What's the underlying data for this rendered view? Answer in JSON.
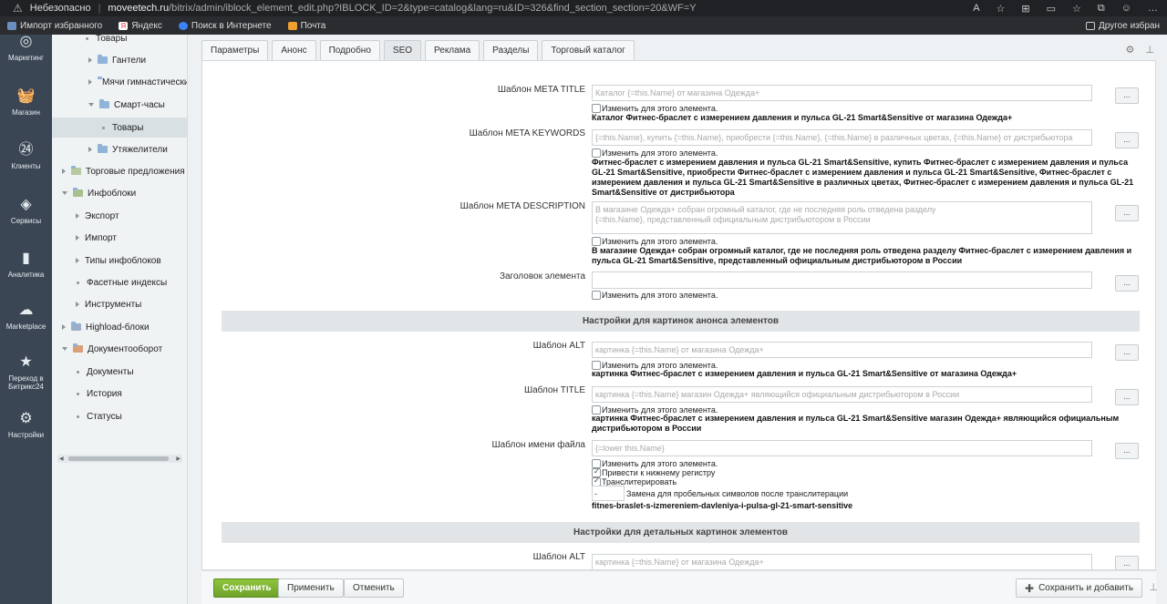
{
  "browser": {
    "security": "Небезопасно",
    "url_host": "moveetech.ru",
    "url_path": "/bitrix/admin/iblock_element_edit.php?IBLOCK_ID=2&type=catalog&lang=ru&ID=326&find_section_section=20&WF=Y",
    "bookmarks": [
      "Импорт избранного",
      "Яндекс",
      "Поиск в Интернете",
      "Почта"
    ],
    "other_bookmarks": "Другое избран"
  },
  "leftbar": [
    "Маркетинг",
    "Магазин",
    "Клиенты",
    "Сервисы",
    "Аналитика",
    "Marketplace",
    "Переход в Битрикс24",
    "Настройки"
  ],
  "tree": [
    {
      "label": "Товары",
      "type": "dot"
    },
    {
      "label": "Гантели",
      "type": "folder"
    },
    {
      "label": "Мячи гимнастические",
      "type": "folder"
    },
    {
      "label": "Смарт-часы",
      "type": "folder-open"
    },
    {
      "label": "Товары",
      "type": "dot",
      "selected": true
    },
    {
      "label": "Утяжелители",
      "type": "folder"
    },
    {
      "label": "Торговые предложения",
      "type": "top"
    },
    {
      "label": "Инфоблоки",
      "type": "top-open"
    },
    {
      "label": "Экспорт",
      "type": "sub"
    },
    {
      "label": "Импорт",
      "type": "sub"
    },
    {
      "label": "Типы инфоблоков",
      "type": "sub"
    },
    {
      "label": "Фасетные индексы",
      "type": "subdot"
    },
    {
      "label": "Инструменты",
      "type": "sub"
    },
    {
      "label": "Highload-блоки",
      "type": "top"
    },
    {
      "label": "Документооборот",
      "type": "top-open"
    },
    {
      "label": "Документы",
      "type": "subdot"
    },
    {
      "label": "История",
      "type": "subdot"
    },
    {
      "label": "Статусы",
      "type": "subdot"
    }
  ],
  "tabs": [
    "Параметры",
    "Анонс",
    "Подробно",
    "SEO",
    "Реклама",
    "Разделы",
    "Торговый каталог"
  ],
  "active_tab": "SEO",
  "form": {
    "meta_title_label": "Шаблон META TITLE",
    "meta_title_value": "Каталог {=this.Name} от магазина Одежда+",
    "meta_title_preview": "Каталог Фитнес-браслет с измерением давления и пульса GL-21 Smart&Sensitive от магазина Одежда+",
    "meta_keywords_label": "Шаблон META KEYWORDS",
    "meta_keywords_value": "{=this.Name}, купить {=this.Name}, приобрести {=this.Name}, {=this.Name} в различных цветах, {=this.Name} от дистрибьютора",
    "meta_keywords_preview": "Фитнес-браслет с измерением давления и пульса GL-21 Smart&Sensitive, купить Фитнес-браслет с измерением давления и пульса GL-21 Smart&Sensitive, приобрести Фитнес-браслет с измерением давления и пульса GL-21 Smart&Sensitive, Фитнес-браслет с измерением давления и пульса GL-21 Smart&Sensitive в различных цветах, Фитнес-браслет с измерением давления и пульса GL-21 Smart&Sensitive от дистрибьютора",
    "meta_description_label": "Шаблон META DESCRIPTION",
    "meta_description_value": "В магазине Одежда+ собран огромный каталог, где не последняя роль отведена разделу {=this.Name}, представленный официальным дистрибьютором в России",
    "meta_description_preview": "В магазине Одежда+ собран огромный каталог, где не последняя роль отведена разделу Фитнес-браслет с измерением давления и пульса GL-21 Smart&Sensitive, представленный официальным дистрибьютором в России",
    "heading_label": "Заголовок элемента",
    "heading_value": "",
    "change_for_element": "Изменить для этого элемента.",
    "section_announce": "Настройки для картинок анонса элементов",
    "alt_label": "Шаблон ALT",
    "announce_alt_value": "картинка {=this.Name} от магазина Одежда+",
    "announce_alt_preview": "картинка Фитнес-браслет с измерением давления и пульса GL-21 Smart&Sensitive от магазина Одежда+",
    "title_label": "Шаблон TITLE",
    "announce_title_value": "картинка {=this.Name} магазин Одежда+ являющийся официальным дистрибьютором в России",
    "announce_title_preview": "картинка Фитнес-браслет с измерением давления и пульса GL-21 Smart&Sensitive магазин Одежда+ являющийся официальным дистрибьютором в России",
    "filename_label": "Шаблон имени файла",
    "filename_value": "{=lower this.Name}",
    "lowercase_label": "Привести к нижнему регистру",
    "translit_label": "Транслитерировать",
    "space_replace_value": "-",
    "space_replace_label": "Замена для пробельных символов после транслитерации",
    "filename_preview": "fitnes-braslet-s-izmereniem-davleniya-i-pulsa-gl-21-smart-sensitive",
    "section_detail": "Настройки для детальных картинок элементов",
    "detail_alt_value": "картинка {=this.Name} от магазина Одежда+",
    "dots": "..."
  },
  "footer": {
    "save": "Сохранить",
    "apply": "Применить",
    "cancel": "Отменить",
    "save_add": "Сохранить и добавить"
  }
}
